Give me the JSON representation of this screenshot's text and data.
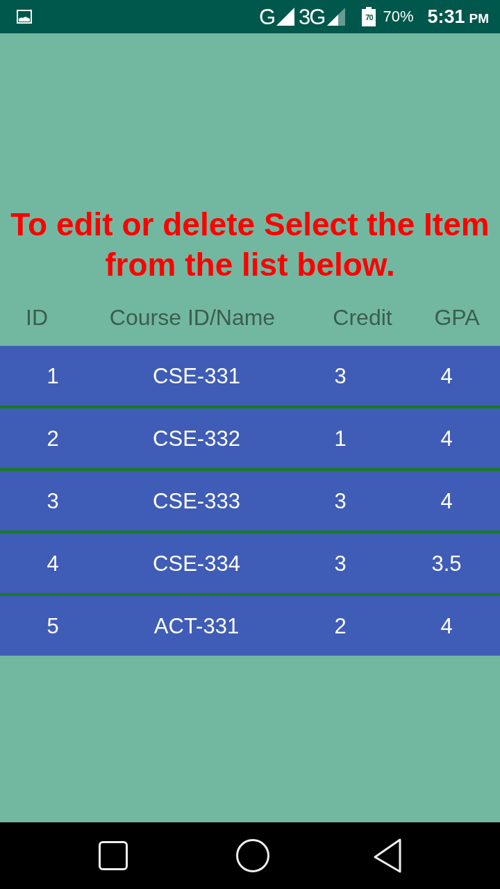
{
  "status_bar": {
    "network_1": "G",
    "network_2": "3G",
    "battery_icon_label": "70",
    "battery": "70%",
    "time": "5:31",
    "time_suffix": "PM"
  },
  "instruction": "To edit or delete Select the Item from the list below.",
  "table": {
    "columns": [
      "ID",
      "Course ID/Name",
      "Credit",
      "GPA"
    ],
    "rows": [
      {
        "id": "1",
        "course": "CSE-331",
        "credit": "3",
        "gpa": "4",
        "selected": false
      },
      {
        "id": "2",
        "course": "CSE-332",
        "credit": "1",
        "gpa": "4",
        "selected": false
      },
      {
        "id": "3",
        "course": "CSE-333",
        "credit": "3",
        "gpa": "4",
        "selected": false
      },
      {
        "id": "4",
        "course": "CSE-334",
        "credit": "3",
        "gpa": "3.5",
        "selected": false
      },
      {
        "id": "5",
        "course": "ACT-331",
        "credit": "2",
        "gpa": "4",
        "selected": false
      }
    ]
  }
}
